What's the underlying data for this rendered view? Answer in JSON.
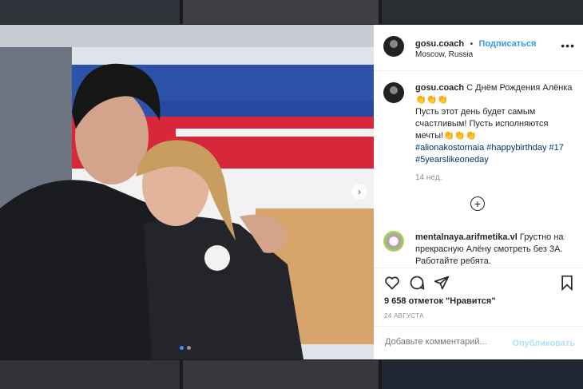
{
  "post": {
    "username": "gosu.coach",
    "follow_label": "Подписаться",
    "separator": "•",
    "location": "Moscow, Russia",
    "more_label": "•••",
    "caption_user": "gosu.coach",
    "caption_line1": " С Днём Рождения Алёнка👏👏👏",
    "caption_line2": "Пусть этот день будет самым счастливым! Пусть исполняются мечты!👏👏👏",
    "hashtags": "#alionakostornaia #happybirthday #17 #5yearslikeoneday",
    "age": "14 нед.",
    "load_more": "+",
    "comment_user": "mentalnaya.arifmetika.vl",
    "comment_text": " Грустно на прекрасную Алёну смотреть без 3А. Работайте ребята.",
    "likes": "9 658 отметок \"Нравится\"",
    "date": "24 АВГУСТА",
    "add_comment_placeholder": "Добавьте комментарий...",
    "publish_label": "Опубликовать",
    "next_label": "›"
  }
}
